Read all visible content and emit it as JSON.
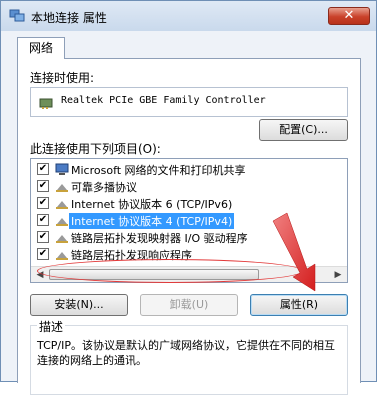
{
  "window": {
    "title": "本地连接 属性",
    "close_glyph": "✕"
  },
  "tabs": [
    {
      "label": "网络"
    }
  ],
  "connect_using_label": "连接时使用:",
  "adapter_name": "Realtek PCIe GBE Family Controller",
  "configure_button": "配置(C)...",
  "items_label": "此连接使用下列项目(O):",
  "items": [
    {
      "label": "Microsoft 网络的文件和打印机共享",
      "checked": true,
      "icon": "network-share-icon"
    },
    {
      "label": "可靠多播协议",
      "checked": true,
      "icon": "protocol-icon"
    },
    {
      "label": "Internet 协议版本 6 (TCP/IPv6)",
      "checked": true,
      "icon": "protocol-icon"
    },
    {
      "label": "Internet 协议版本 4 (TCP/IPv4)",
      "checked": true,
      "icon": "protocol-icon",
      "selected": true
    },
    {
      "label": "链路层拓扑发现映射器 I/O 驱动程序",
      "checked": true,
      "icon": "protocol-icon"
    },
    {
      "label": "链路层拓扑发现响应程序",
      "checked": true,
      "icon": "protocol-icon"
    }
  ],
  "buttons": {
    "install": "安装(N)...",
    "uninstall": "卸载(U)",
    "properties": "属性(R)"
  },
  "description": {
    "title": "描述",
    "text": "TCP/IP。该协议是默认的广域网络协议，它提供在不同的相互连接的网络上的通讯。"
  },
  "colors": {
    "annotation": "#e23a3a",
    "selection": "#3399ff"
  }
}
